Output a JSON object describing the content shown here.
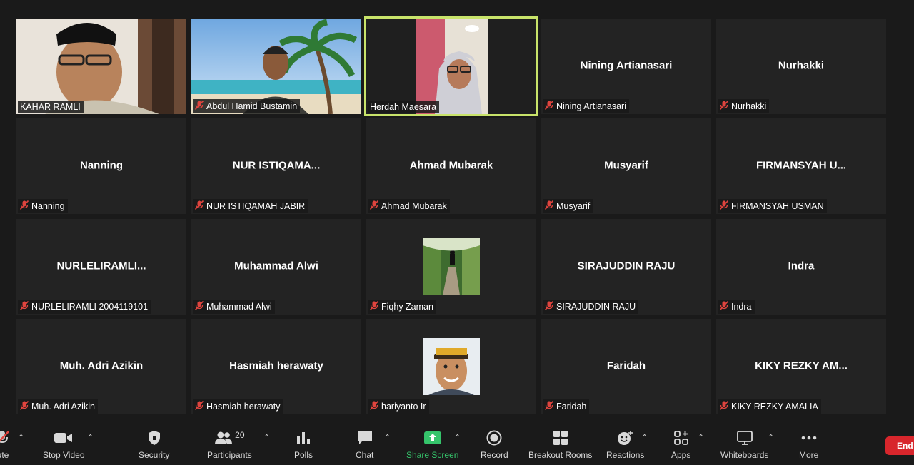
{
  "participants": [
    {
      "tile_name": "",
      "label": "KAHAR RAMLI",
      "muted": false,
      "media": "video-1",
      "active": false
    },
    {
      "tile_name": "",
      "label": "Abdul Hamid Bustamin",
      "muted": true,
      "media": "video-2",
      "active": false
    },
    {
      "tile_name": "",
      "label": "Herdah Maesara",
      "muted": false,
      "media": "video-3",
      "active": true
    },
    {
      "tile_name": "Nining Artianasari",
      "label": "Nining Artianasari",
      "muted": true,
      "media": "none",
      "active": false
    },
    {
      "tile_name": "Nurhakki",
      "label": "Nurhakki",
      "muted": true,
      "media": "none",
      "active": false
    },
    {
      "tile_name": "Nanning",
      "label": "Nanning",
      "muted": true,
      "media": "none",
      "active": false
    },
    {
      "tile_name": "NUR  ISTIQAMA...",
      "label": "NUR ISTIQAMAH JABIR",
      "muted": true,
      "media": "none",
      "active": false
    },
    {
      "tile_name": "Ahmad Mubarak",
      "label": "Ahmad Mubarak",
      "muted": true,
      "media": "none",
      "active": false
    },
    {
      "tile_name": "Musyarif",
      "label": "Musyarif",
      "muted": true,
      "media": "none",
      "active": false
    },
    {
      "tile_name": "FIRMANSYAH  U...",
      "label": "FIRMANSYAH USMAN",
      "muted": true,
      "media": "none",
      "active": false
    },
    {
      "tile_name": "NURLELIRAMLI...",
      "label": "NURLELIRAMLI 2004119101",
      "muted": true,
      "media": "none",
      "active": false
    },
    {
      "tile_name": "Muhammad Alwi",
      "label": "Muhammad Alwi",
      "muted": true,
      "media": "none",
      "active": false
    },
    {
      "tile_name": "",
      "label": "Fiqhy Zaman",
      "muted": true,
      "media": "avatar-path",
      "active": false
    },
    {
      "tile_name": "SIRAJUDDIN RAJU",
      "label": "SIRAJUDDIN RAJU",
      "muted": true,
      "media": "none",
      "active": false
    },
    {
      "tile_name": "Indra",
      "label": "Indra",
      "muted": true,
      "media": "none",
      "active": false
    },
    {
      "tile_name": "Muh. Adri Azikin",
      "label": "Muh. Adri Azikin",
      "muted": true,
      "media": "none",
      "active": false
    },
    {
      "tile_name": "Hasmiah herawaty",
      "label": "Hasmiah herawaty",
      "muted": true,
      "media": "none",
      "active": false
    },
    {
      "tile_name": "",
      "label": "hariyanto Ir",
      "muted": true,
      "media": "avatar-face",
      "active": false
    },
    {
      "tile_name": "Faridah",
      "label": "Faridah",
      "muted": true,
      "media": "none",
      "active": false
    },
    {
      "tile_name": "KIKY  REZKY  AM...",
      "label": "KIKY REZKY AMALIA",
      "muted": true,
      "media": "none",
      "active": false
    }
  ],
  "toolbar": {
    "mute": "ute",
    "stop_video": "Stop Video",
    "security": "Security",
    "participants": "Participants",
    "participants_count": "20",
    "polls": "Polls",
    "chat": "Chat",
    "share_screen": "Share Screen",
    "record": "Record",
    "breakout_rooms": "Breakout Rooms",
    "reactions": "Reactions",
    "apps": "Apps",
    "whiteboards": "Whiteboards",
    "more": "More",
    "end": "End"
  },
  "colors": {
    "active_speaker": "#c8e36a",
    "muted_icon": "#e0443e",
    "share_green": "#35c46b",
    "end_red": "#d8262c"
  }
}
